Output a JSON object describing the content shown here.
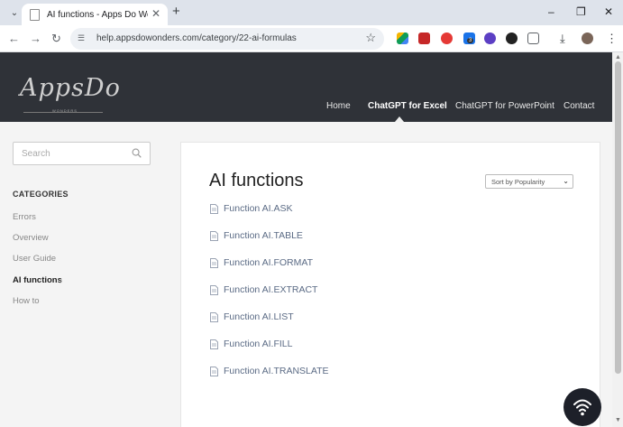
{
  "browser": {
    "tab_title": "AI functions - Apps Do Wonde",
    "url": "help.appsdowonders.com/category/22-ai-formulas",
    "ext_badge": "3"
  },
  "site": {
    "logo_text": "AppsDo",
    "logo_tagline": "WONDERS",
    "nav": [
      "Home",
      "ChatGPT for Excel",
      "ChatGPT for PowerPoint",
      "Contact"
    ],
    "active_nav": "ChatGPT for Excel"
  },
  "sidebar": {
    "search_placeholder": "Search",
    "categories_title": "CATEGORIES",
    "items": [
      "Errors",
      "Overview",
      "User Guide",
      "AI functions",
      "How to"
    ],
    "active_item": "AI functions"
  },
  "main": {
    "title": "AI functions",
    "sort_label": "Sort by Popularity",
    "articles": [
      "Function AI.ASK",
      "Function AI.TABLE",
      "Function AI.FORMAT",
      "Function AI.EXTRACT",
      "Function AI.LIST",
      "Function AI.FILL",
      "Function AI.TRANSLATE"
    ]
  },
  "colors": {
    "header_bg": "#2f3238",
    "link": "#5b6b85",
    "content_bg": "#f4f4f4"
  }
}
